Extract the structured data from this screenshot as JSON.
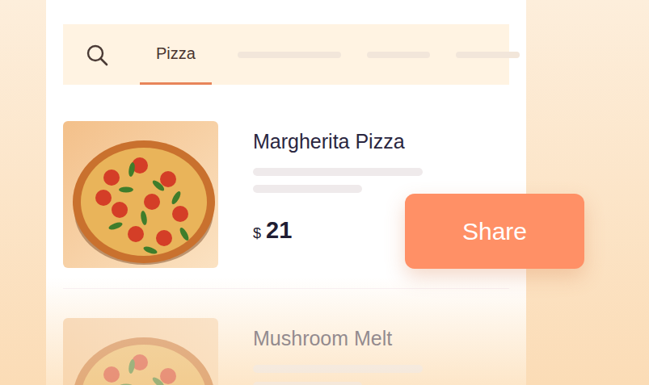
{
  "tabs": [
    {
      "label": "Pizza",
      "selected": true
    }
  ],
  "search": {
    "icon": true
  },
  "items": [
    {
      "name": "Margherita Pizza",
      "currency": "$",
      "price": "21",
      "faded": false
    },
    {
      "name": "Mushroom Melt",
      "currency": "",
      "price": "",
      "faded": true
    }
  ],
  "share_button": {
    "label": "Share"
  }
}
